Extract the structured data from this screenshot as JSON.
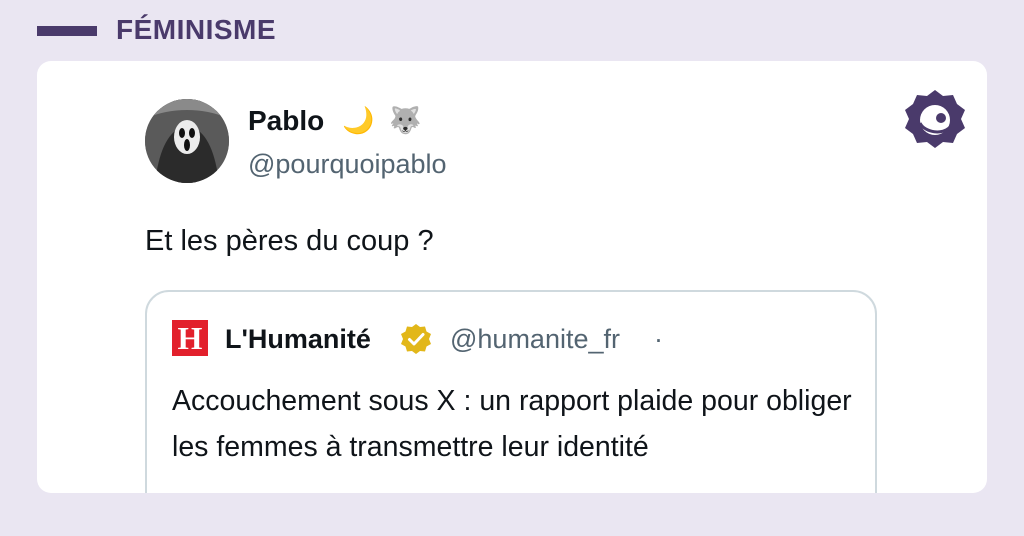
{
  "category": {
    "label": "FÉMINISME"
  },
  "tweet": {
    "author_name": "Pablo",
    "author_emojis": [
      "🌙",
      "🐺"
    ],
    "author_handle": "@pourquoipablo",
    "text": "Et les pères du coup ?",
    "avatar_icon": "ghostface-avatar"
  },
  "quoted_tweet": {
    "logo_letter": "H",
    "author_name": "L'Humanité",
    "verified_icon": "verified-badge-gold",
    "author_handle": "@humanite_fr",
    "separator": "·",
    "text": "Accouchement sous X : un rapport plaide pour obliger les femmes à transmettre leur identité"
  },
  "brand": {
    "icon": "brand-logo-icon"
  },
  "colors": {
    "background": "#eae6f2",
    "accent": "#4a3a6b",
    "card": "#ffffff",
    "handle_gray": "#536471",
    "logo_red": "#e2202c",
    "verified_gold": "#e2b719"
  }
}
